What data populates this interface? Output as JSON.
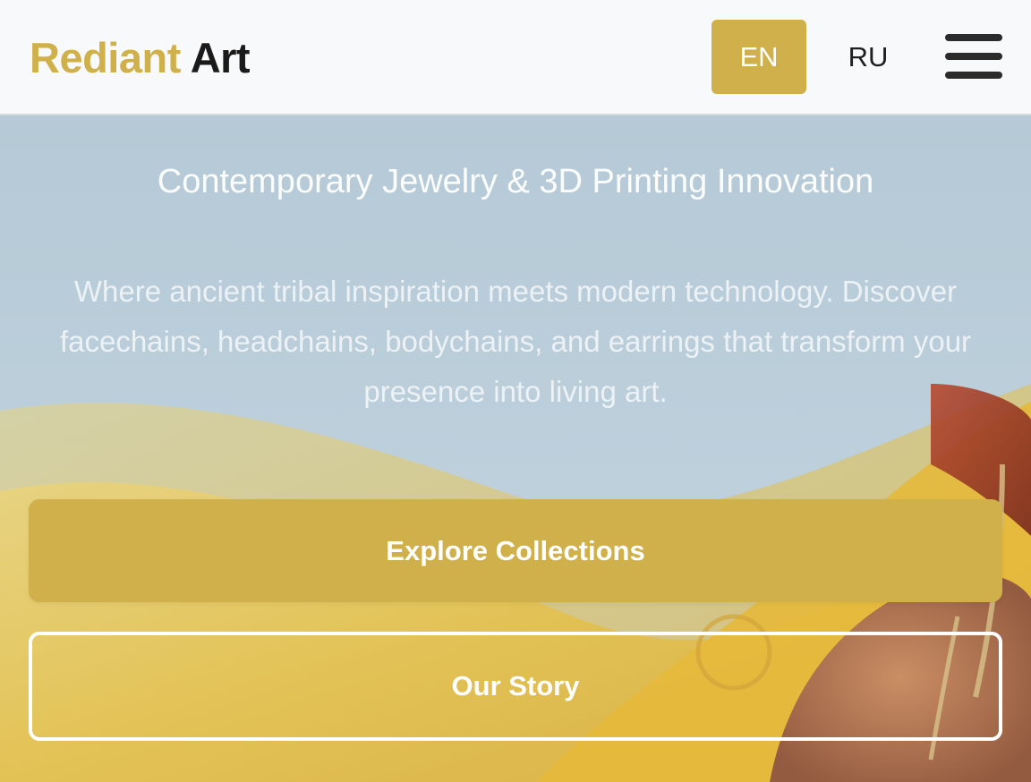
{
  "header": {
    "logo_part1": "Rediant",
    "logo_part2": "Art",
    "languages": [
      {
        "label": "EN",
        "active": true
      },
      {
        "label": "RU",
        "active": false
      }
    ],
    "menu_icon": "hamburger-menu-icon"
  },
  "hero": {
    "tagline": "Contemporary Jewelry & 3D Printing Innovation",
    "description": "Where ancient tribal inspiration meets modern technology. Discover facechains, headchains, bodychains, and earrings that transform your presence into living art.",
    "primary_button": "Explore Collections",
    "secondary_button": "Our Story",
    "background_image": "photo of a woman in a yellow veil wearing a gold facechain"
  },
  "colors": {
    "accent": "#cfb04a",
    "text_dark": "#1a1a1a",
    "header_bg": "#f8f9fb",
    "sky": "#b7ccd9",
    "veil_yellow": "#e9c24a"
  }
}
